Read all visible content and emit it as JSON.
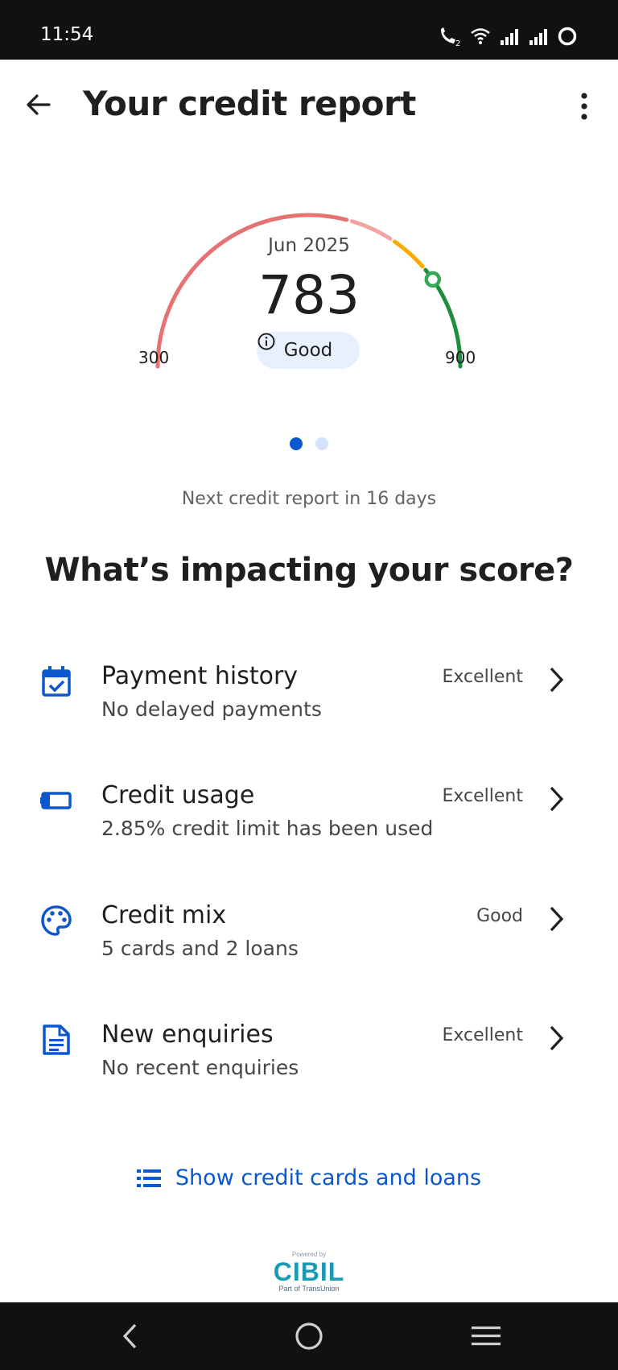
{
  "status_bar": {
    "time": "11:54"
  },
  "app_bar": {
    "title": "Your credit report"
  },
  "gauge": {
    "month": "Jun 2025",
    "score": "783",
    "rating": "Good",
    "min_label": "300",
    "max_label": "900",
    "score_value": 783,
    "range": [
      300,
      900
    ],
    "colors": {
      "low": "#e57373",
      "fair": "#f4a3a3",
      "mid": "#f9ab00",
      "good": "#1e8e3e",
      "marker": "#34a853"
    }
  },
  "pager": {
    "count": 2,
    "active_index": 0
  },
  "next_report": "Next credit report in 16 days",
  "section_heading": "What’s impacting your score?",
  "factors": [
    {
      "title": "Payment history",
      "subtitle": "No delayed payments",
      "rating": "Excellent",
      "icon": "calendar-check-icon"
    },
    {
      "title": "Credit usage",
      "subtitle": "2.85% credit limit has been used",
      "rating": "Excellent",
      "icon": "credit-usage-icon"
    },
    {
      "title": "Credit mix",
      "subtitle": "5 cards and 2 loans",
      "rating": "Good",
      "icon": "palette-icon"
    },
    {
      "title": "New enquiries",
      "subtitle": "No recent enquiries",
      "rating": "Excellent",
      "icon": "document-icon"
    }
  ],
  "show_link": {
    "label": "Show credit cards and loans"
  },
  "footer": {
    "powered_by": "Powered by",
    "brand": "CIBIL",
    "part_of": "Part of TransUnion"
  },
  "theme": {
    "accent": "#0b57d0",
    "accent_light": "#e8f0fe"
  }
}
